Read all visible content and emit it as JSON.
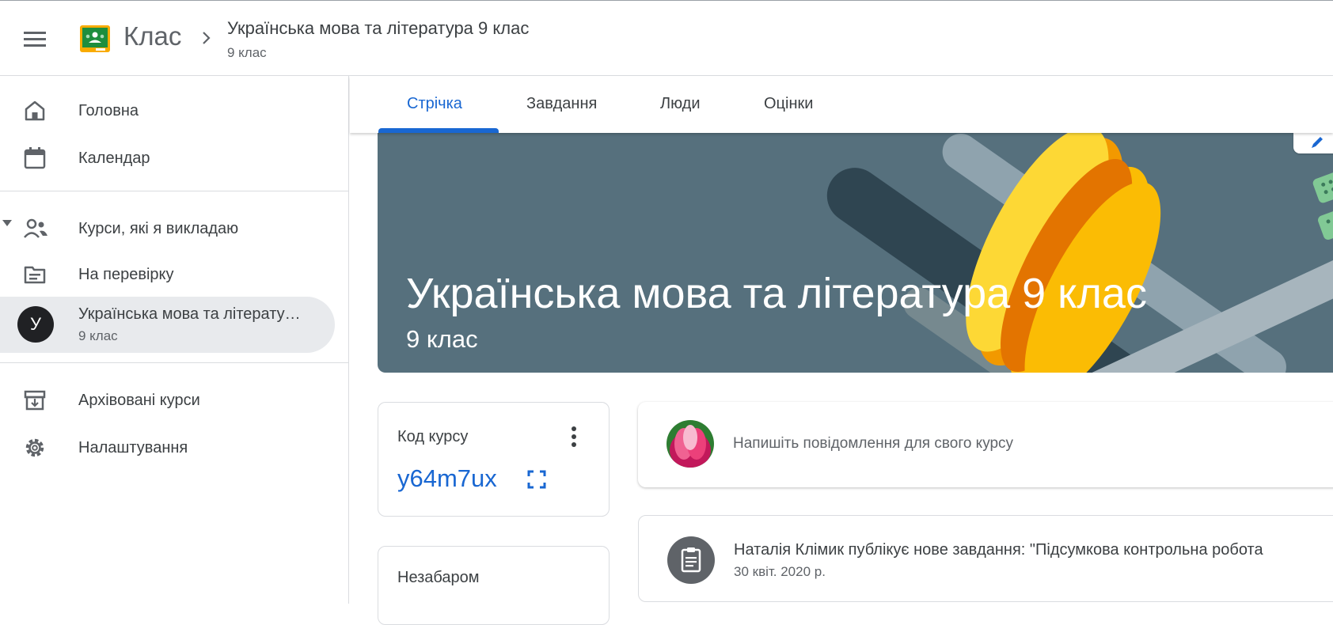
{
  "header": {
    "app_name": "Клас",
    "course_title": "Українська мова та література 9 клас",
    "course_subtitle": "9 клас"
  },
  "sidebar": {
    "home": "Головна",
    "calendar": "Календар",
    "teaching": "Курси, які я викладаю",
    "to_review": "На перевірку",
    "course_avatar": "У",
    "course_name": "Українська мова та літерату…",
    "course_sub": "9 клас",
    "archived": "Архівовані курси",
    "settings": "Налаштування"
  },
  "tabs": [
    {
      "label": "Стрічка",
      "active": true
    },
    {
      "label": "Завдання",
      "active": false
    },
    {
      "label": "Люди",
      "active": false
    },
    {
      "label": "Оцінки",
      "active": false
    }
  ],
  "banner": {
    "title": "Українська мова та література 9 клас",
    "subtitle": "9 клас"
  },
  "code_card": {
    "label": "Код курсу",
    "value": "y64m7ux"
  },
  "upcoming": {
    "label": "Незабаром"
  },
  "compose": {
    "placeholder": "Напишіть повідомлення для свого курсу"
  },
  "stream": [
    {
      "text": "Наталія Клімик публікує нове завдання: \"Підсумкова контрольна робота",
      "date": "30 квіт. 2020 р."
    }
  ],
  "colors": {
    "accent": "#1967d2",
    "banner": "#56707d",
    "active_bg": "#e8eaed"
  }
}
